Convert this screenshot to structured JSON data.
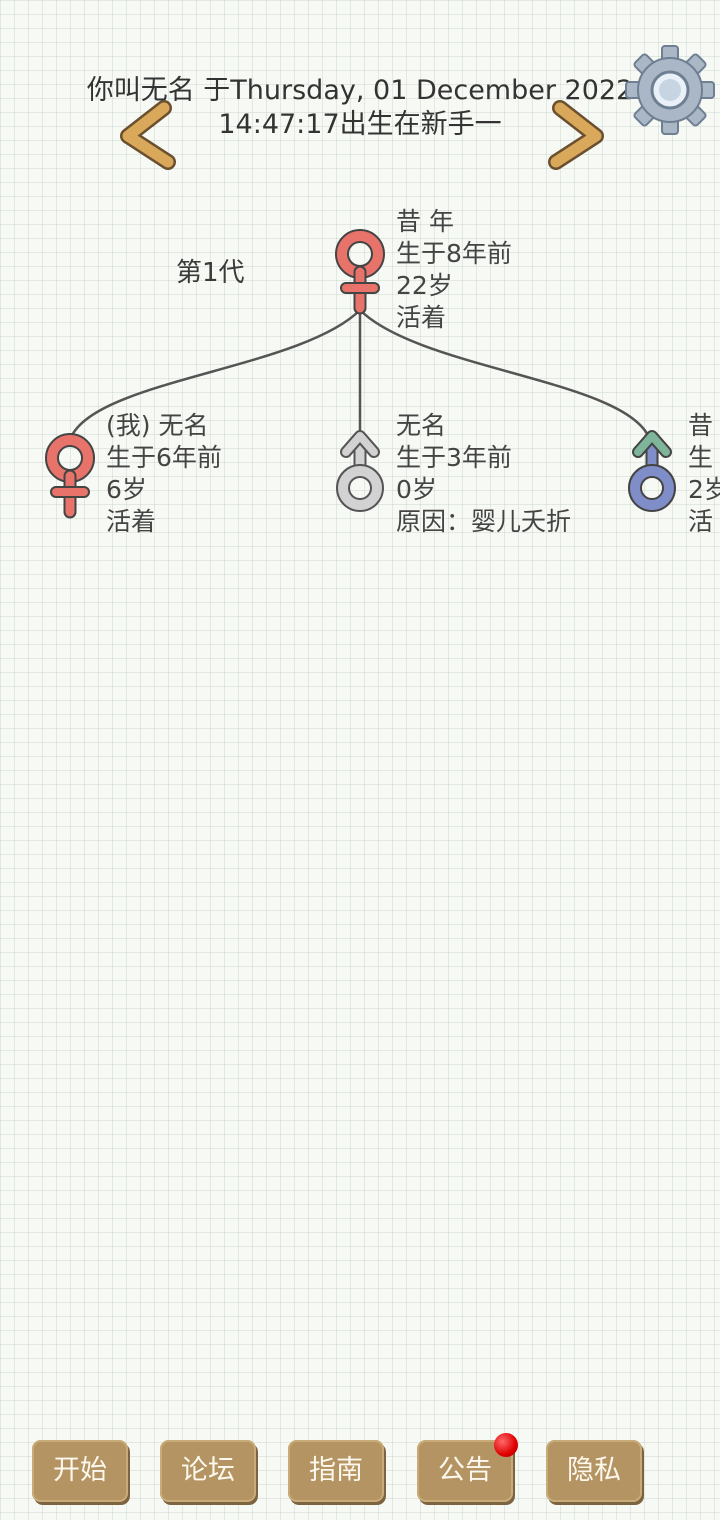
{
  "header": {
    "line1": "你叫无名 于Thursday, 01 December 2022",
    "line2": "14:47:17出生在新手一"
  },
  "generation_label": "第1代",
  "tree": {
    "parent": {
      "gender": "female",
      "lines": [
        "昔 年",
        "生于8年前",
        "22岁",
        "活着"
      ]
    },
    "children": [
      {
        "gender": "female",
        "lines": [
          "(我) 无名",
          "生于6年前",
          "6岁",
          "活着"
        ]
      },
      {
        "gender": "male-deceased",
        "lines": [
          "无名",
          "生于3年前",
          "0岁",
          "原因：婴儿夭折"
        ]
      },
      {
        "gender": "male",
        "lines": [
          "昔",
          "生",
          "2岁",
          "活"
        ]
      }
    ]
  },
  "buttons": {
    "start": "开始",
    "forum": "论坛",
    "guide": "指南",
    "notice": "公告",
    "privacy": "隐私"
  },
  "icons": {
    "prev": "chevron-left-icon",
    "next": "chevron-right-icon",
    "settings": "gear-icon",
    "female": "female-symbol-icon",
    "male": "male-symbol-icon"
  },
  "colors": {
    "button_bg": "#b39462",
    "female": "#e8736a",
    "male": "#7f8ec9",
    "deceased": "#c9c9c9",
    "badge": "#e00000"
  }
}
